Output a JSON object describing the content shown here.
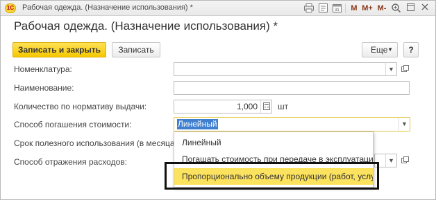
{
  "window": {
    "app_badge": "1С",
    "title": "Рабочая одежда. (Назначение использования) *",
    "toolbar_m": "M",
    "toolbar_m_plus": "M+",
    "toolbar_m_minus": "M-"
  },
  "form": {
    "title": "Рабочая одежда. (Назначение использования) *",
    "buttons": {
      "save_close": "Записать и закрыть",
      "save": "Записать",
      "more": "Еще",
      "help": "?"
    },
    "fields": {
      "nomenclature_label": "Номенклатура:",
      "nomenclature_value": "",
      "name_label": "Наименование:",
      "name_value": "",
      "quantity_label": "Количество по нормативу выдачи:",
      "quantity_value": "1,000",
      "quantity_unit": "шт",
      "method_label": "Способ погашения стоимости:",
      "method_value": "Линейный",
      "useful_life_label": "Срок полезного использования (в месяцах):",
      "expense_label": "Способ отражения расходов:"
    },
    "dropdown": {
      "options": [
        "Линейный",
        "Погашать стоимость при передаче в эксплуатацию",
        "Пропорционально объему продукции (работ, услуг)"
      ],
      "highlighted_index": 2
    }
  },
  "colors": {
    "accent_yellow": "#f6c800",
    "highlight_yellow": "#fbe25f",
    "selection_blue": "#3f7fd0"
  }
}
